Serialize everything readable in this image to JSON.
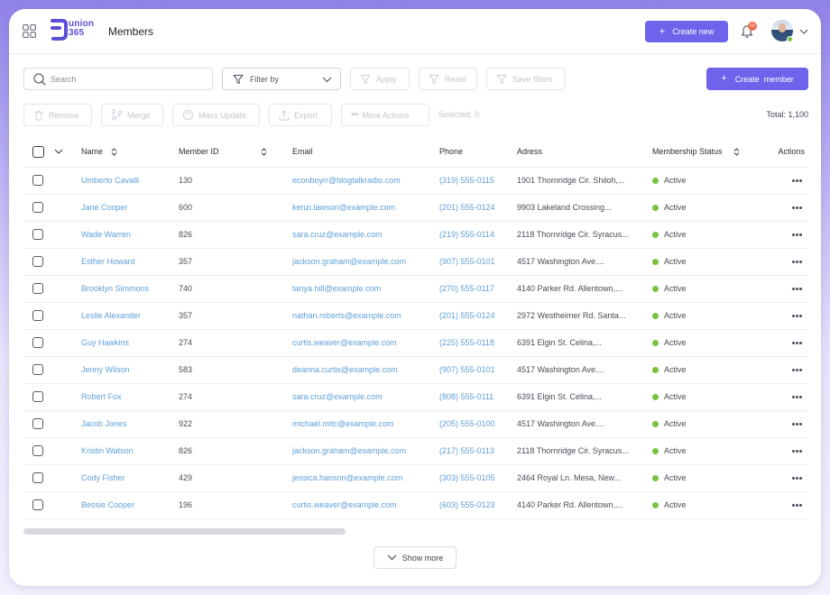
{
  "header": {
    "logo_text_top": "union",
    "logo_text_bottom": "365",
    "title": "Members",
    "create_new_label": "Create new",
    "notification_count": "03",
    "brand_color": "#6e63ea"
  },
  "toolbar": {
    "search_placeholder": "Search",
    "filter_label": "Filter by",
    "apply_label": "Apply",
    "reset_label": "Reset",
    "save_filters_label": "Save filters",
    "create_member_label": "Create  member",
    "remove_label": "Remove",
    "merge_label": "Merge",
    "mass_update_label": "Mass Update",
    "export_label": "Export",
    "more_actions_label": "More Actions",
    "selected_text": "Selected: 0",
    "total_text": "Total: 1,100"
  },
  "table": {
    "columns": {
      "name": "Name",
      "member_id": "Member ID",
      "email": "Email",
      "phone": "Phone",
      "address": "Adress",
      "status": "Membership Status",
      "actions": "Actions"
    },
    "status_color": "#7ac143",
    "rows": [
      {
        "name": "Umberto Cavalli",
        "id": "130",
        "email": "econboyrr@blogtalkradio.com",
        "phone": "(319) 555-0115",
        "address": "1901 Thornridge Cir. Shiloh,...",
        "status": "Active"
      },
      {
        "name": "Jane Cooper",
        "id": "600",
        "email": "kenzi.lawson@example.com",
        "phone": "(201) 555-0124",
        "address": "9903 Lakeland Crossing...",
        "status": "Active"
      },
      {
        "name": "Wade Warren",
        "id": "826",
        "email": "sara.cruz@example.com",
        "phone": "(219) 555-0114",
        "address": "2118 Thornridge Cir. Syracus...",
        "status": "Active"
      },
      {
        "name": "Esther Howard",
        "id": "357",
        "email": "jackson.graham@example.com",
        "phone": "(907) 555-0101",
        "address": "4517 Washington Ave....",
        "status": "Active"
      },
      {
        "name": "Brooklyn Simmons",
        "id": "740",
        "email": "tanya.hill@example.com",
        "phone": "(270) 555-0117",
        "address": "4140 Parker Rd. Allentown,...",
        "status": "Active"
      },
      {
        "name": "Leslie Alexander",
        "id": "357",
        "email": "nathan.roberts@example.com",
        "phone": "(201) 555-0124",
        "address": "2972 Westheimer Rd. Santa...",
        "status": "Active"
      },
      {
        "name": "Guy Hawkins",
        "id": "274",
        "email": "curtis.weaver@example.com",
        "phone": "(225) 555-0118",
        "address": "6391 Elgin St. Celina,...",
        "status": "Active"
      },
      {
        "name": "Jenny Wilson",
        "id": "583",
        "email": "deanna.curtis@example.com",
        "phone": "(907) 555-0101",
        "address": "4517 Washington Ave....",
        "status": "Active"
      },
      {
        "name": "Robert Fox",
        "id": "274",
        "email": "sara.cruz@example.com",
        "phone": "(808) 555-0111",
        "address": "6391 Elgin St. Celina,...",
        "status": "Active"
      },
      {
        "name": "Jacob Jones",
        "id": "922",
        "email": "michael.mitc@example.com",
        "phone": "(205) 555-0100",
        "address": "4517 Washington Ave....",
        "status": "Active"
      },
      {
        "name": "Kristin Watson",
        "id": "826",
        "email": "jackson.graham@example.com",
        "phone": "(217) 555-0113",
        "address": "2118 Thornridge Cir. Syracus...",
        "status": "Active"
      },
      {
        "name": "Cody Fisher",
        "id": "429",
        "email": "jessica.hanson@example.com",
        "phone": "(303) 555-0105",
        "address": "2464 Royal Ln. Mesa, New...",
        "status": "Active"
      },
      {
        "name": "Bessie Cooper",
        "id": "196",
        "email": "curtis.weaver@example.com",
        "phone": "(603) 555-0123",
        "address": "4140 Parker Rd. Allentown,...",
        "status": "Active"
      }
    ]
  },
  "footer": {
    "show_more_label": "Show more"
  }
}
